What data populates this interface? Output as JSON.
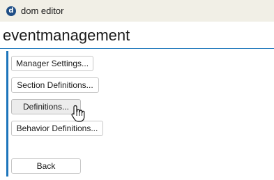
{
  "window": {
    "app_icon": "d",
    "title": "dom editor"
  },
  "page": {
    "title": "eventmanagement"
  },
  "buttons": {
    "manager_settings": "Manager Settings...",
    "section_definitions": "Section Definitions...",
    "definitions": "Definitions...",
    "behavior_definitions": "Behavior Definitions...",
    "back": "Back"
  },
  "colors": {
    "accent": "#1c75bb",
    "titlebar": "#f1efe6"
  },
  "cursor": {
    "icon": "hand-pointer-icon",
    "hovering": "definitions-button"
  }
}
